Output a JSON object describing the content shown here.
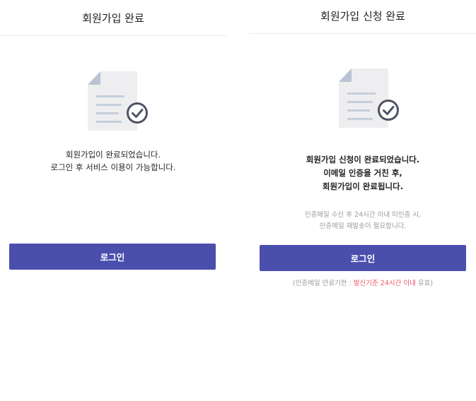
{
  "left_screen": {
    "title": "회원가입 완료",
    "icon": "document-check-icon",
    "message_lines": [
      "회원가입이 완료되었습니다.",
      "로그인 후 서비스 이용이 가능합니다."
    ],
    "login_label": "로그인"
  },
  "right_screen": {
    "title": "회원가입 신청 완료",
    "icon": "document-check-icon",
    "message_lines": [
      "회원가입 신청이 완료되었습니다.",
      "이메일 인증을 거친 후,",
      "회원가입이 완료됩니다."
    ],
    "note_lines": [
      "인증메일 수신 후 24시간 이내 미인증 시,",
      "인증메일 재발송이 필요합니다."
    ],
    "login_label": "로그인",
    "expiry": {
      "prefix": "(인증메일 만료기한 : ",
      "highlight": "발신기준 24시간 이내",
      "suffix": " 유효)"
    }
  },
  "colors": {
    "button": "#4a4ead",
    "highlight": "#f0566b",
    "icon_paper": "#eeeef0",
    "icon_fold": "#b9c3d3",
    "icon_lines": "#c5cedb",
    "icon_check": "#4f5263"
  }
}
